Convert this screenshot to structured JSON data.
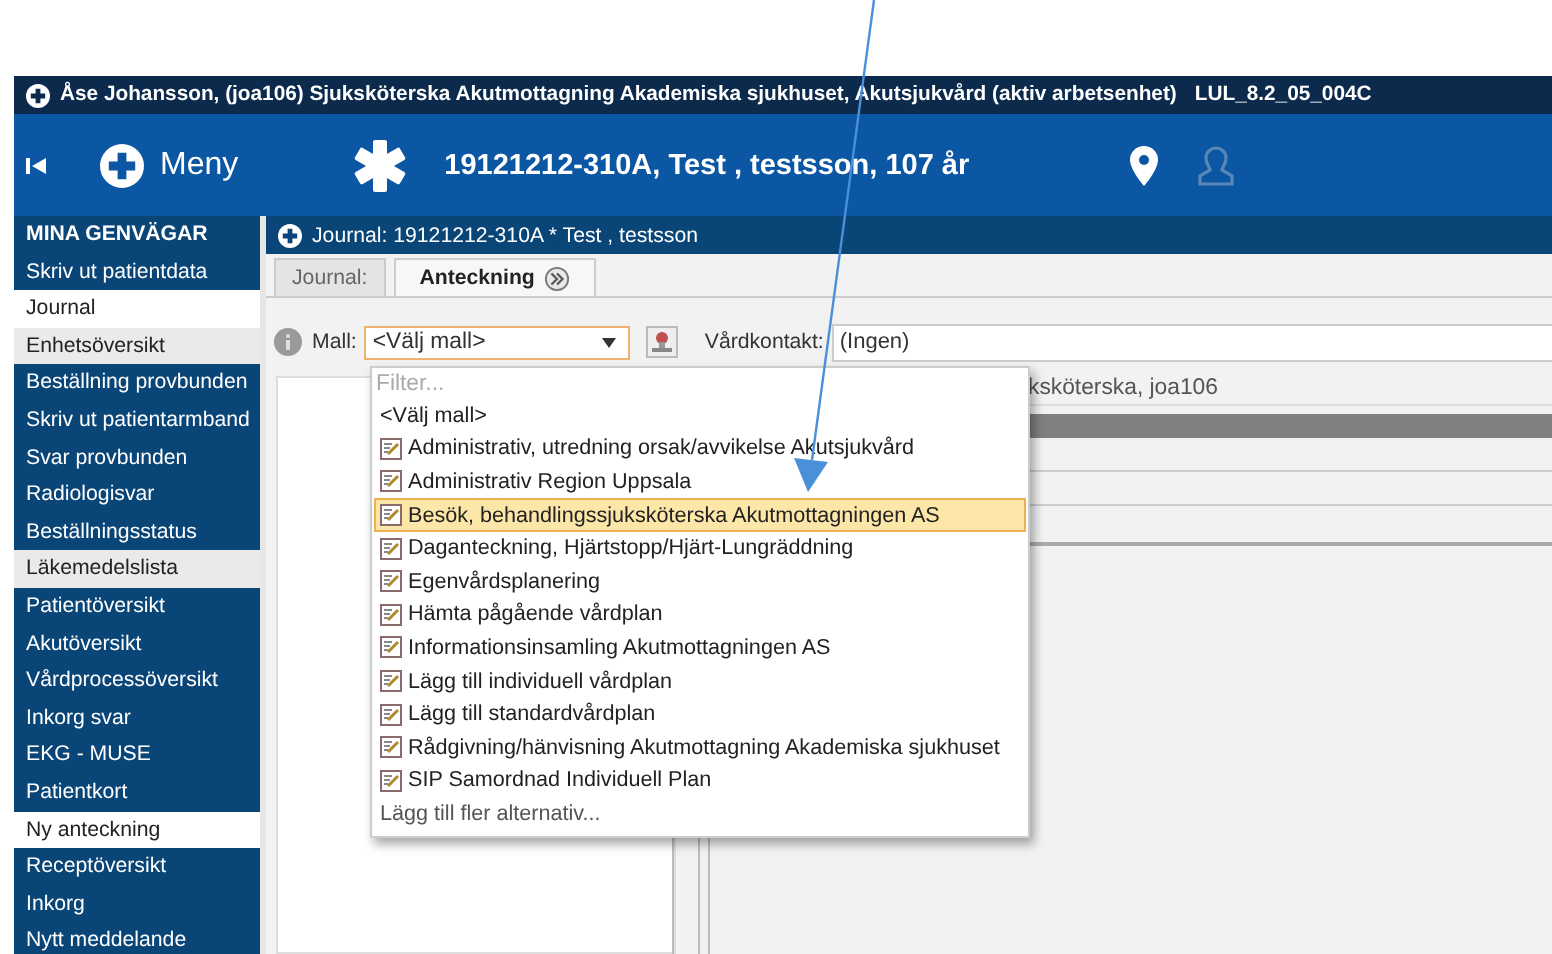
{
  "top_bar": {
    "user": "Åse  Johansson, (joa106) Sjuksköterska Akutmottagning Akademiska sjukhuset, Akutsjukvård (aktiv arbetsenhet)",
    "version": "LUL_8.2_05_004C"
  },
  "header": {
    "menu_label": "Meny",
    "patient": "19121212-310A,  Test , testsson,  107 år"
  },
  "sidebar": {
    "heading": "MINA GENVÄGAR",
    "items": [
      {
        "label": "Skriv ut patientdata",
        "selected": false,
        "shaded": false
      },
      {
        "label": "Journal",
        "selected": true,
        "shaded": false
      },
      {
        "label": "Enhetsöversikt",
        "selected": false,
        "shaded": true
      },
      {
        "label": "Beställning provbunden",
        "selected": false,
        "shaded": false
      },
      {
        "label": "Skriv ut patientarmband",
        "selected": false,
        "shaded": false
      },
      {
        "label": "Svar provbunden",
        "selected": false,
        "shaded": false
      },
      {
        "label": "Radiologisvar",
        "selected": false,
        "shaded": false
      },
      {
        "label": "Beställningsstatus",
        "selected": false,
        "shaded": false
      },
      {
        "label": "Läkemedelslista",
        "selected": false,
        "shaded": true
      },
      {
        "label": "Patientöversikt",
        "selected": false,
        "shaded": false
      },
      {
        "label": "Akutöversikt",
        "selected": false,
        "shaded": false
      },
      {
        "label": "Vårdprocessöversikt",
        "selected": false,
        "shaded": false
      },
      {
        "label": "Inkorg svar",
        "selected": false,
        "shaded": false
      },
      {
        "label": "EKG - MUSE",
        "selected": false,
        "shaded": false
      },
      {
        "label": "Patientkort",
        "selected": false,
        "shaded": false
      },
      {
        "label": "Ny anteckning",
        "selected": true,
        "shaded": false
      },
      {
        "label": "Receptöversikt",
        "selected": false,
        "shaded": false
      },
      {
        "label": "Inkorg",
        "selected": false,
        "shaded": false
      },
      {
        "label": "Nytt meddelande",
        "selected": false,
        "shaded": false
      }
    ]
  },
  "journal": {
    "title": "Journal: 19121212-310A * Test , testsson",
    "tabs": [
      {
        "label": "Journal:",
        "selected": false,
        "closable": false
      },
      {
        "label": "Anteckning",
        "selected": true,
        "closable": true
      }
    ],
    "mall_label": "Mall:",
    "mall_value": "<Välj mall>",
    "contact_label": "Vårdkontakt:",
    "contact_value": "(Ingen)",
    "author_text": "ksköterska, joa106",
    "dropdown": {
      "filter_placeholder": "Filter...",
      "items": [
        {
          "label": "<Välj mall>",
          "kind": "plain",
          "selected": false
        },
        {
          "label": "Administrativ, utredning orsak/avvikelse Akutsjukvård",
          "kind": "template",
          "selected": false
        },
        {
          "label": "Administrativ Region Uppsala",
          "kind": "template",
          "selected": false
        },
        {
          "label": "Besök, behandlingssjuksköterska Akutmottagningen AS",
          "kind": "template",
          "selected": true
        },
        {
          "label": "Daganteckning, Hjärtstopp/Hjärt-Lungräddning",
          "kind": "template",
          "selected": false
        },
        {
          "label": "Egenvårdsplanering",
          "kind": "template",
          "selected": false
        },
        {
          "label": "Hämta pågående vårdplan",
          "kind": "template",
          "selected": false
        },
        {
          "label": "Informationsinsamling Akutmottagningen AS",
          "kind": "template",
          "selected": false
        },
        {
          "label": "Lägg till individuell vårdplan",
          "kind": "template",
          "selected": false
        },
        {
          "label": "Lägg till standardvårdplan",
          "kind": "template",
          "selected": false
        },
        {
          "label": "Rådgivning/hänvisning Akutmottagning Akademiska sjukhuset",
          "kind": "template",
          "selected": false
        },
        {
          "label": "SIP Samordnad Individuell Plan",
          "kind": "template",
          "selected": false
        },
        {
          "label": "Lägg till fler alternativ...",
          "kind": "more",
          "selected": false
        }
      ]
    }
  }
}
